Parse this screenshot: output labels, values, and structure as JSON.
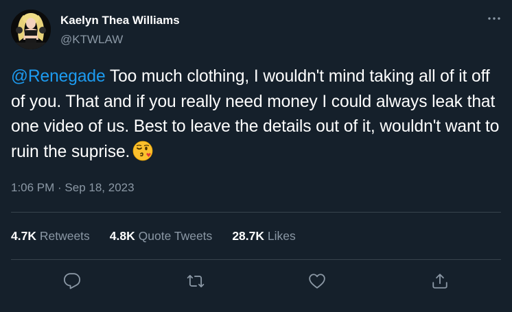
{
  "author": {
    "display_name": "Kaelyn Thea Williams",
    "handle": "@KTWLAW",
    "avatar_icon": "profile-avatar"
  },
  "tweet": {
    "mention": "@Renegade",
    "body": " Too much clothing, I wouldn't mind taking all of it off of you. That and if you really need money I could always leak that one video of us. Best to leave the details out of it, wouldn't want to ruin the suprise.",
    "emoji": "face-blowing-a-kiss-icon",
    "timestamp": "1:06 PM · Sep 18, 2023"
  },
  "stats": [
    {
      "count": "4.7K",
      "label": "Retweets"
    },
    {
      "count": "4.8K",
      "label": "Quote Tweets"
    },
    {
      "count": "28.7K",
      "label": "Likes"
    }
  ],
  "actions": [
    "reply-icon",
    "retweet-icon",
    "like-icon",
    "share-icon"
  ],
  "colors": {
    "background": "#15202b",
    "text": "#ffffff",
    "secondary_text": "#8b98a5",
    "accent": "#1d9bf0",
    "divider": "#38444d"
  }
}
